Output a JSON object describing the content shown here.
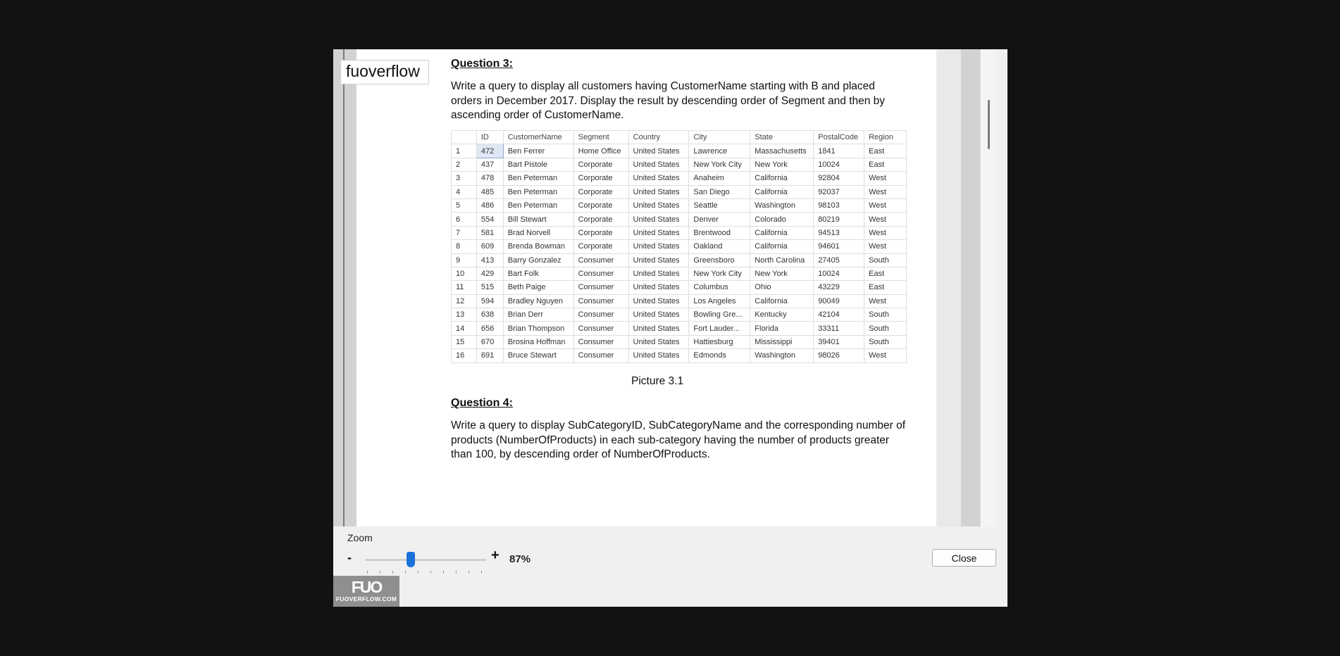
{
  "watermark": "fuoverflow",
  "questions": [
    {
      "heading": "Question 3:",
      "text": "Write a query to display all customers having CustomerName starting with B and placed orders in December 2017. Display the result by descending order of Segment and then by ascending order of CustomerName."
    },
    {
      "heading": "Question 4:",
      "text": "Write a query to display SubCategoryID, SubCategoryName and the corresponding number of products (NumberOfProducts) in each sub-category having the number of products greater than 100, by descending order of NumberOfProducts."
    }
  ],
  "table": {
    "columns": [
      "",
      "ID",
      "CustomerName",
      "Segment",
      "Country",
      "City",
      "State",
      "PostalCode",
      "Region"
    ],
    "rows": [
      [
        "1",
        "472",
        "Ben Ferrer",
        "Home Office",
        "United States",
        "Lawrence",
        "Massachusetts",
        "1841",
        "East"
      ],
      [
        "2",
        "437",
        "Bart Pistole",
        "Corporate",
        "United States",
        "New York City",
        "New York",
        "10024",
        "East"
      ],
      [
        "3",
        "478",
        "Ben Peterman",
        "Corporate",
        "United States",
        "Anaheim",
        "California",
        "92804",
        "West"
      ],
      [
        "4",
        "485",
        "Ben Peterman",
        "Corporate",
        "United States",
        "San Diego",
        "California",
        "92037",
        "West"
      ],
      [
        "5",
        "486",
        "Ben Peterman",
        "Corporate",
        "United States",
        "Seattle",
        "Washington",
        "98103",
        "West"
      ],
      [
        "6",
        "554",
        "Bill Stewart",
        "Corporate",
        "United States",
        "Denver",
        "Colorado",
        "80219",
        "West"
      ],
      [
        "7",
        "581",
        "Brad Norvell",
        "Corporate",
        "United States",
        "Brentwood",
        "California",
        "94513",
        "West"
      ],
      [
        "8",
        "609",
        "Brenda Bowman",
        "Corporate",
        "United States",
        "Oakland",
        "California",
        "94601",
        "West"
      ],
      [
        "9",
        "413",
        "Barry Gonzalez",
        "Consumer",
        "United States",
        "Greensboro",
        "North Carolina",
        "27405",
        "South"
      ],
      [
        "10",
        "429",
        "Bart Folk",
        "Consumer",
        "United States",
        "New York City",
        "New York",
        "10024",
        "East"
      ],
      [
        "11",
        "515",
        "Beth Paige",
        "Consumer",
        "United States",
        "Columbus",
        "Ohio",
        "43229",
        "East"
      ],
      [
        "12",
        "594",
        "Bradley Nguyen",
        "Consumer",
        "United States",
        "Los Angeles",
        "California",
        "90049",
        "West"
      ],
      [
        "13",
        "638",
        "Brian Derr",
        "Consumer",
        "United States",
        "Bowling Gre...",
        "Kentucky",
        "42104",
        "South"
      ],
      [
        "14",
        "656",
        "Brian Thompson",
        "Consumer",
        "United States",
        "Fort Lauder...",
        "Florida",
        "33311",
        "South"
      ],
      [
        "15",
        "670",
        "Brosina Hoffman",
        "Consumer",
        "United States",
        "Hattiesburg",
        "Mississippi",
        "39401",
        "South"
      ],
      [
        "16",
        "691",
        "Bruce Stewart",
        "Consumer",
        "United States",
        "Edmonds",
        "Washington",
        "98026",
        "West"
      ]
    ]
  },
  "caption": "Picture 3.1",
  "zoom": {
    "label": "Zoom",
    "minus": "-",
    "plus": "+",
    "value": "87%",
    "level": 87
  },
  "close_label": "Close",
  "logo": {
    "mark": "FUO",
    "text": "FUOVERFLOW.COM"
  }
}
